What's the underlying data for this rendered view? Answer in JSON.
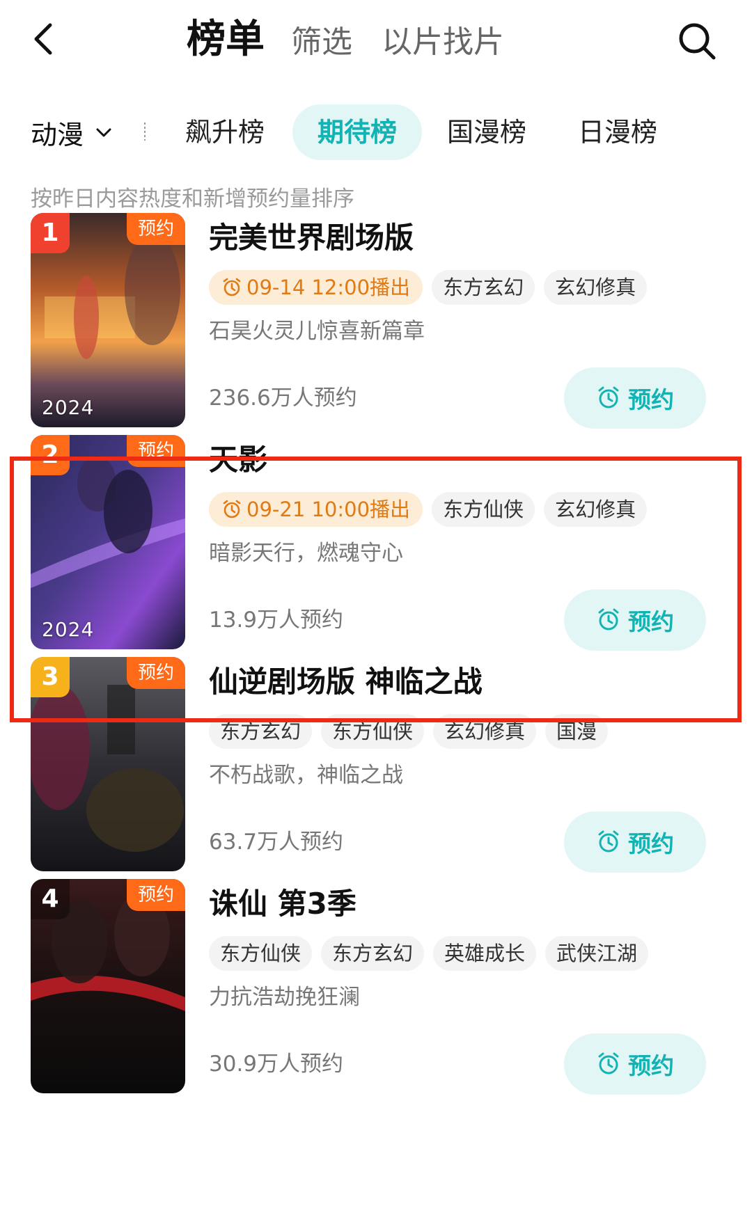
{
  "header": {
    "tabs": [
      "榜单",
      "筛选",
      "以片找片"
    ]
  },
  "category": {
    "dropdown_label": "动漫",
    "tabs": [
      "飙升榜",
      "期待榜",
      "国漫榜",
      "日漫榜"
    ],
    "active_tab": "期待榜"
  },
  "subtitle": "按昨日内容热度和新增预约量排序",
  "colors": {
    "accent": "#13b3b3",
    "accent_bg": "#e2f6f6",
    "time_tag_bg": "#fdecd6",
    "time_tag_text": "#e07a14",
    "badge_orange": "#ff6a19",
    "highlight_border": "#ef2a14"
  },
  "items": [
    {
      "rank": "1",
      "badge": "预约",
      "year": "2024",
      "title": "完美世界剧场版",
      "time": "09-14 12:00播出",
      "tags": [
        "东方玄幻",
        "玄幻修真"
      ],
      "desc": "石昊火灵儿惊喜新篇章",
      "count": "236.6万人预约",
      "button": "预约",
      "rank_color": "#f0412e"
    },
    {
      "rank": "2",
      "badge": "预约",
      "year": "2024",
      "title": "天影",
      "time": "09-21 10:00播出",
      "tags": [
        "东方仙侠",
        "玄幻修真"
      ],
      "desc": "暗影天行，燃魂守心",
      "count": "13.9万人预约",
      "button": "预约",
      "rank_color": "#ff6a19"
    },
    {
      "rank": "3",
      "badge": "预约",
      "year": "",
      "title": "仙逆剧场版 神临之战",
      "time": "",
      "tags": [
        "东方玄幻",
        "东方仙侠",
        "玄幻修真",
        "国漫"
      ],
      "desc": "不朽战歌，神临之战",
      "count": "63.7万人预约",
      "button": "预约",
      "rank_color": "#f7b21b"
    },
    {
      "rank": "4",
      "badge": "预约",
      "year": "",
      "title": "诛仙 第3季",
      "time": "",
      "tags": [
        "东方仙侠",
        "东方玄幻",
        "英雄成长",
        "武侠江湖"
      ],
      "desc": "力抗浩劫挽狂澜",
      "count": "30.9万人预约",
      "button": "预约",
      "rank_color": "rgba(0,0,0,0.35)"
    }
  ]
}
